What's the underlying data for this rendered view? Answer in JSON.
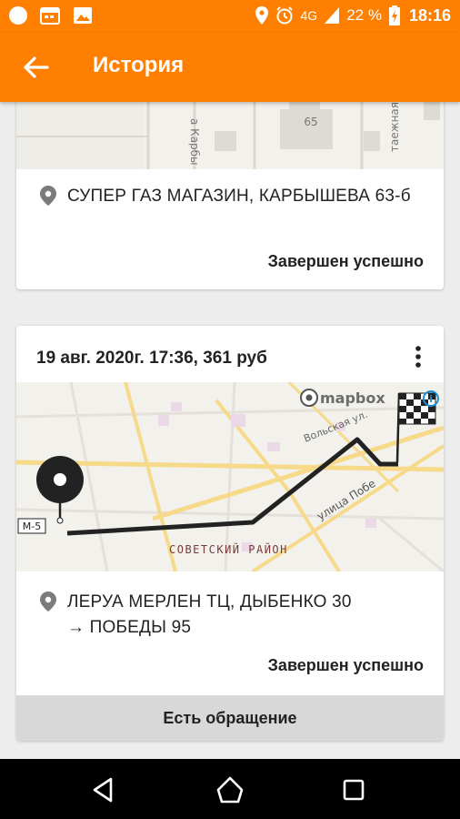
{
  "status_bar": {
    "battery": "22 %",
    "time": "18:16",
    "network": "4G"
  },
  "app_bar": {
    "title": "История"
  },
  "cards": [
    {
      "address": "СУПЕР ГАЗ МАГАЗИН, КАРБЫШЕВА 63-б",
      "status": "Завершен успешно",
      "map_labels": {
        "building_number": "65",
        "street_left": "а Карбы",
        "street_right": "таежная"
      }
    },
    {
      "title": "19 авг. 2020г. 17:36, 361 руб",
      "address_line1": "ЛЕРУА МЕРЛЕН ТЦ, ДЫБЕНКО 30",
      "address_line2": "→ ПОБЕДЫ 95",
      "status": "Завершен успешно",
      "appeal_label": "Есть обращение",
      "map_labels": {
        "brand": "mapbox",
        "road_shield": "M-5",
        "district": "СОВЕТСКИЙ РАЙОН",
        "street_volskaya": "Вольская ул.",
        "street_pobedy": "улица Побе"
      }
    }
  ],
  "icons": {
    "back": "arrow-left-icon",
    "pin": "location-pin-icon",
    "menu": "more-vert-icon",
    "start": "start-marker-icon",
    "finish": "checkered-flag-icon"
  },
  "colors": {
    "accent": "#ff7f00",
    "route": "#222222",
    "road": "#f7d98a"
  }
}
